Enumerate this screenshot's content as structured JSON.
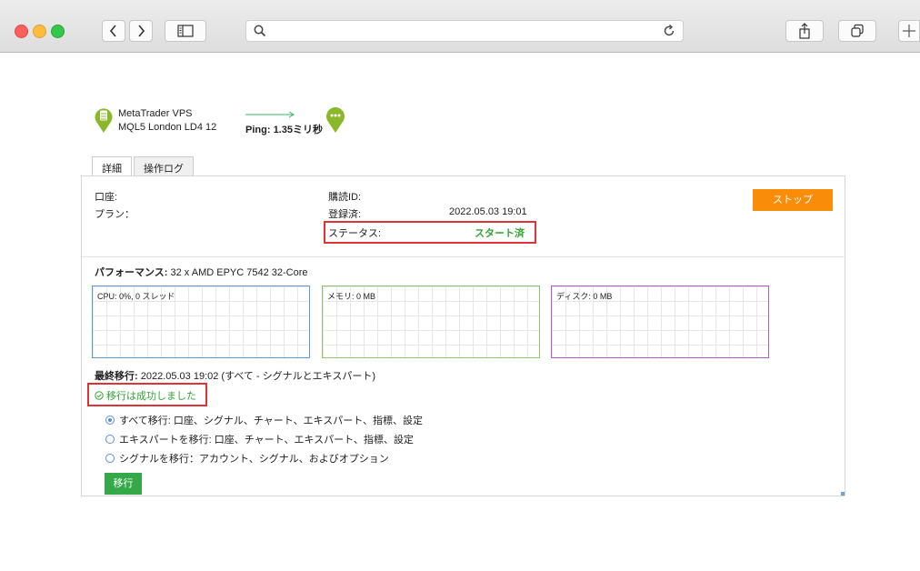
{
  "browser": {
    "url": "",
    "icons": [
      "back-icon",
      "forward-icon",
      "sidebar-icon",
      "search-icon",
      "reload-icon",
      "share-icon",
      "tabs-icon",
      "new-tab-icon"
    ]
  },
  "vps": {
    "name": "MetaTrader VPS",
    "server": "MQL5 London LD4 12",
    "ping_label": "Ping: ",
    "ping_value": "1.35ミリ秒"
  },
  "tabs": [
    {
      "label": "詳細",
      "active": true
    },
    {
      "label": "操作ログ",
      "active": false
    }
  ],
  "details": {
    "account_label": "口座:",
    "plan_label": "プラン：",
    "subscription_id_label": "購読ID:",
    "registered_label": "登録済:",
    "registered_value": "2022.05.03 19:01",
    "status_label": "ステータス:",
    "status_value": "スタート済",
    "stop_button": "ストップ"
  },
  "performance": {
    "label": "パフォーマンス:",
    "value": " 32 x AMD EPYC 7542 32-Core",
    "cpu": "CPU: 0%, 0 スレッド",
    "memory": "メモリ: 0 MB",
    "disk": "ディスク: 0 MB"
  },
  "migration": {
    "last_label": "最終移行:",
    "last_value": " 2022.05.03 19:02 (すべて - シグナルとエキスパート)",
    "success": "移行は成功しました",
    "options": [
      {
        "label": "すべて移行: 口座、シグナル、チャート、エキスパート、指標、設定",
        "checked": true
      },
      {
        "label": "エキスパートを移行: 口座、チャート、エキスパート、指標、設定",
        "checked": false
      },
      {
        "label": "シグナルを移行：アカウント、シグナル、およびオプション",
        "checked": false
      }
    ],
    "button": "移行"
  },
  "colors": {
    "stop": "#f98c09",
    "status_green": "#33a333",
    "highlight_red": "#e03434",
    "migrate_button": "#35a84a"
  }
}
